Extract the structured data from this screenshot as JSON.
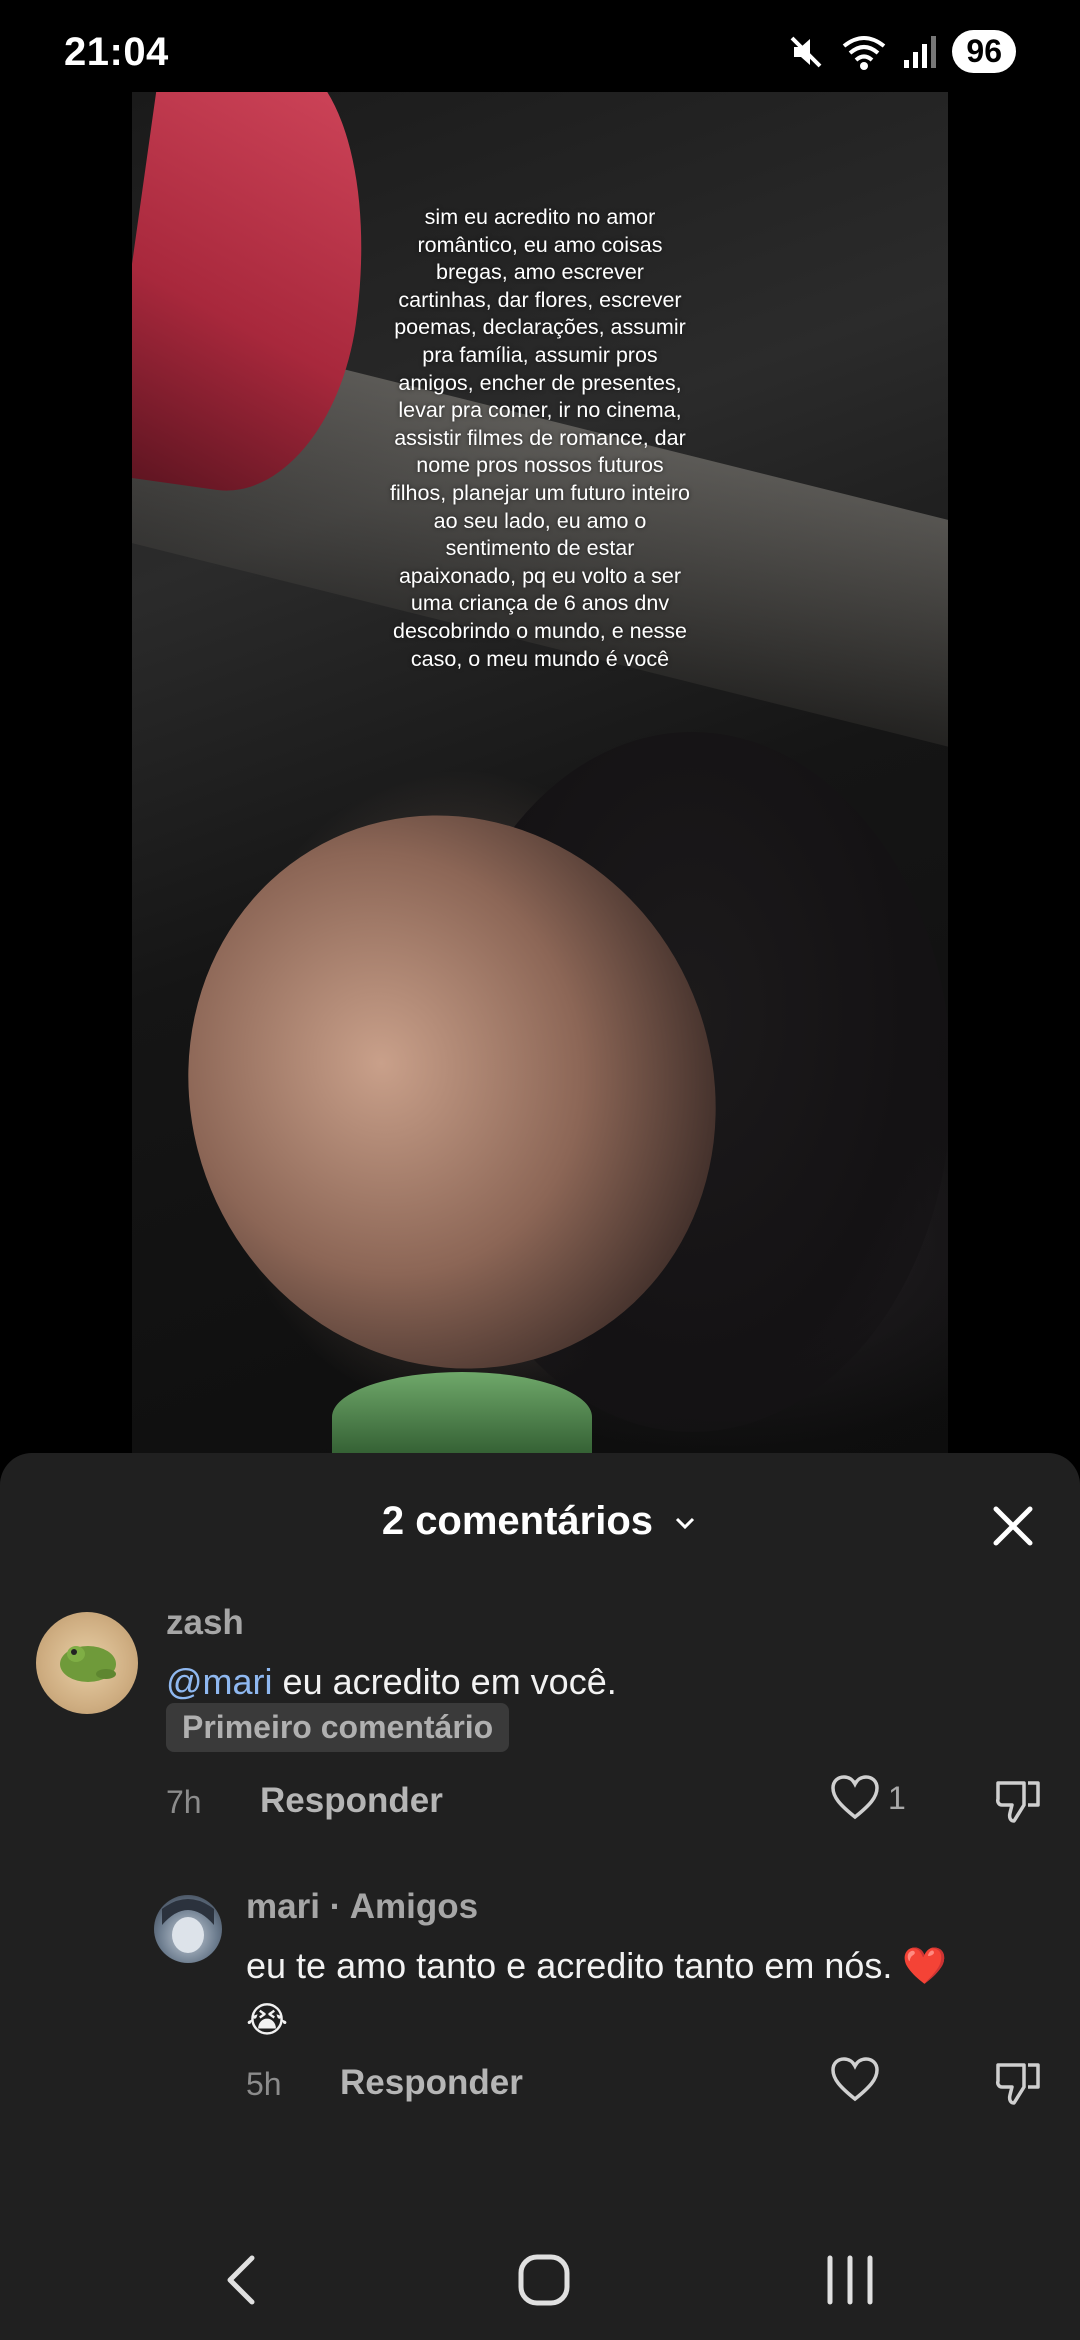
{
  "status_bar": {
    "time": "21:04",
    "battery": "96",
    "icons": [
      "mute-icon",
      "wifi-icon",
      "signal-icon"
    ]
  },
  "video": {
    "caption": "sim eu acredito no amor romântico, eu amo coisas bregas, amo escrever cartinhas, dar flores, escrever poemas, declarações, assumir pra família, assumir pros amigos, encher de presentes, levar pra comer, ir no cinema, assistir filmes de romance, dar nome pros nossos futuros filhos, planejar um futuro inteiro ao seu lado, eu amo o sentimento de estar apaixonado, pq eu volto a ser uma criança de 6 anos dnv descobrindo o mundo, e nesse caso, o meu mundo é você"
  },
  "comments_sheet": {
    "title": "2 comentários",
    "comments": [
      {
        "username": "zash",
        "mention": "@mari",
        "text": " eu acredito em você.",
        "badge": "Primeiro comentário",
        "time": "7h",
        "reply_label": "Responder",
        "likes": "1"
      },
      {
        "username": "mari · Amigos",
        "text": "eu te amo tanto e acredito tanto em nós. ❤️",
        "emoji_line": "😭",
        "time": "5h",
        "reply_label": "Responder",
        "likes": ""
      }
    ]
  },
  "colors": {
    "sheet_bg": "#202020",
    "mention": "#8fb8f0",
    "heart": "#e0242f"
  }
}
